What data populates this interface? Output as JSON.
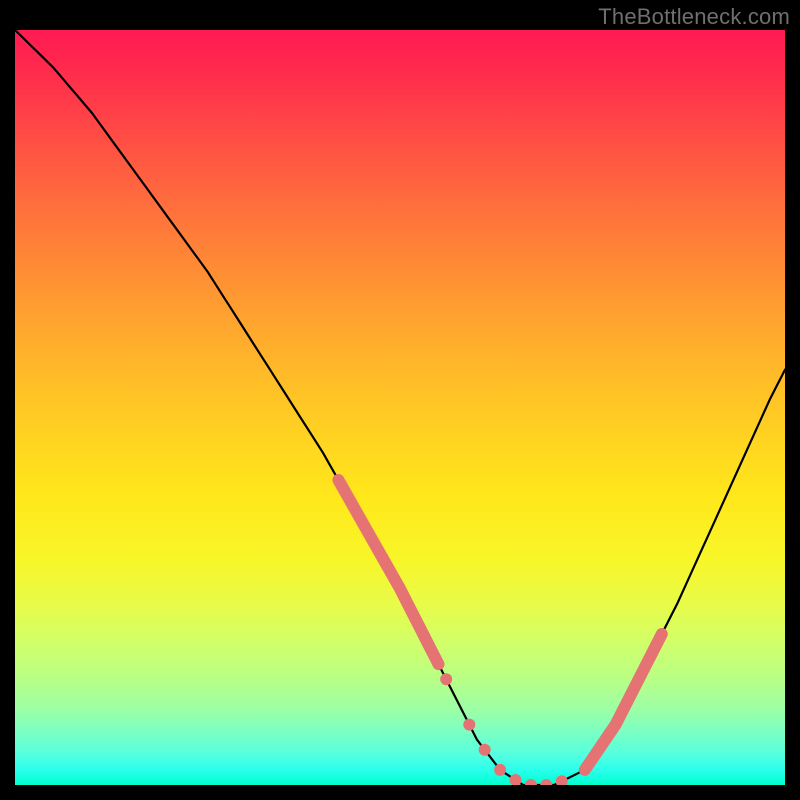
{
  "watermark": "TheBottleneck.com",
  "chart_data": {
    "type": "line",
    "title": "",
    "xlabel": "",
    "ylabel": "",
    "xlim": [
      0,
      100
    ],
    "ylim": [
      0,
      100
    ],
    "description": "Bottleneck curve over red-to-green vertical gradient. Y axis proxies bottleneck percentage (high at top/red, zero at bottom/green). X axis proxies relative hardware balance. Curve descends steeply from top-left, flattens to a valley around x≈55–70 at y≈0, then rises toward the right. Salmon dashed/dotted highlights mark the near-optimal region on both slopes and along the valley floor.",
    "series": [
      {
        "name": "bottleneck-curve",
        "x": [
          0,
          5,
          10,
          15,
          20,
          25,
          30,
          35,
          40,
          45,
          50,
          55,
          58,
          60,
          63,
          66,
          70,
          74,
          78,
          82,
          86,
          90,
          94,
          98,
          100
        ],
        "y": [
          100,
          95,
          89,
          82,
          75,
          68,
          60,
          52,
          44,
          35,
          26,
          16,
          10,
          6,
          2,
          0,
          0,
          2,
          8,
          16,
          24,
          33,
          42,
          51,
          55
        ]
      }
    ],
    "highlight": {
      "left_slope_x": [
        42,
        55
      ],
      "right_slope_x": [
        74,
        84
      ],
      "valley_dots_x": [
        56,
        59,
        61,
        63,
        65,
        67,
        69,
        71
      ]
    },
    "gradient_stops": [
      {
        "pct": 0,
        "color": "#ff1a52"
      },
      {
        "pct": 50,
        "color": "#ffd321"
      },
      {
        "pct": 80,
        "color": "#d2ff68"
      },
      {
        "pct": 100,
        "color": "#00ffcf"
      }
    ]
  }
}
